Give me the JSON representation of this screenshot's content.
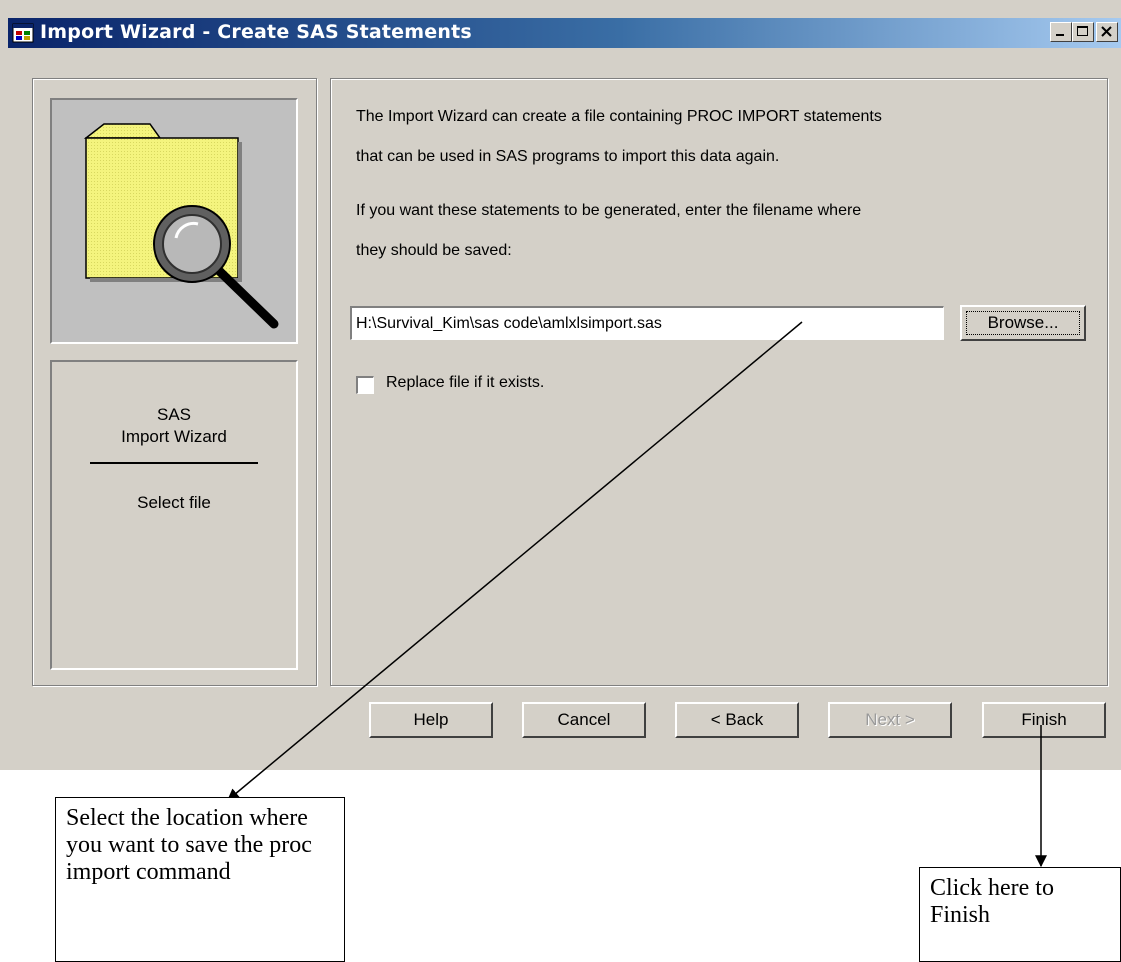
{
  "window": {
    "title": "Import Wizard - Create SAS Statements",
    "controls": {
      "minimize_icon": "minimize-icon",
      "maximize_icon": "maximize-icon",
      "close_icon": "close-icon"
    }
  },
  "sidebar": {
    "image_icon": "folder-magnifier-icon",
    "heading_line1": "SAS",
    "heading_line2": "Import Wizard",
    "step_label": "Select file"
  },
  "main": {
    "description_lines": [
      "The Import Wizard can create a file containing PROC IMPORT statements",
      "that can be used in SAS programs to import this data again.",
      "If you want these statements to be generated, enter the filename where",
      "they should be saved:"
    ],
    "file_path": "H:\\Survival_Kim\\sas code\\amlxlsimport.sas",
    "browse_label": "Browse...",
    "replace_checkbox_label": "Replace file if it exists.",
    "replace_checked": false
  },
  "buttons": {
    "help": "Help",
    "cancel": "Cancel",
    "back": "< Back",
    "next": "Next >",
    "finish": "Finish"
  },
  "annotations": {
    "left_callout": "Select the location where you want to save the proc import command",
    "right_callout": "Click here to Finish"
  },
  "colors": {
    "dialog_bg": "#d4d0c8",
    "titlebar_start": "#0a246a",
    "titlebar_end": "#a6caf0",
    "folder": "#f0f080"
  }
}
